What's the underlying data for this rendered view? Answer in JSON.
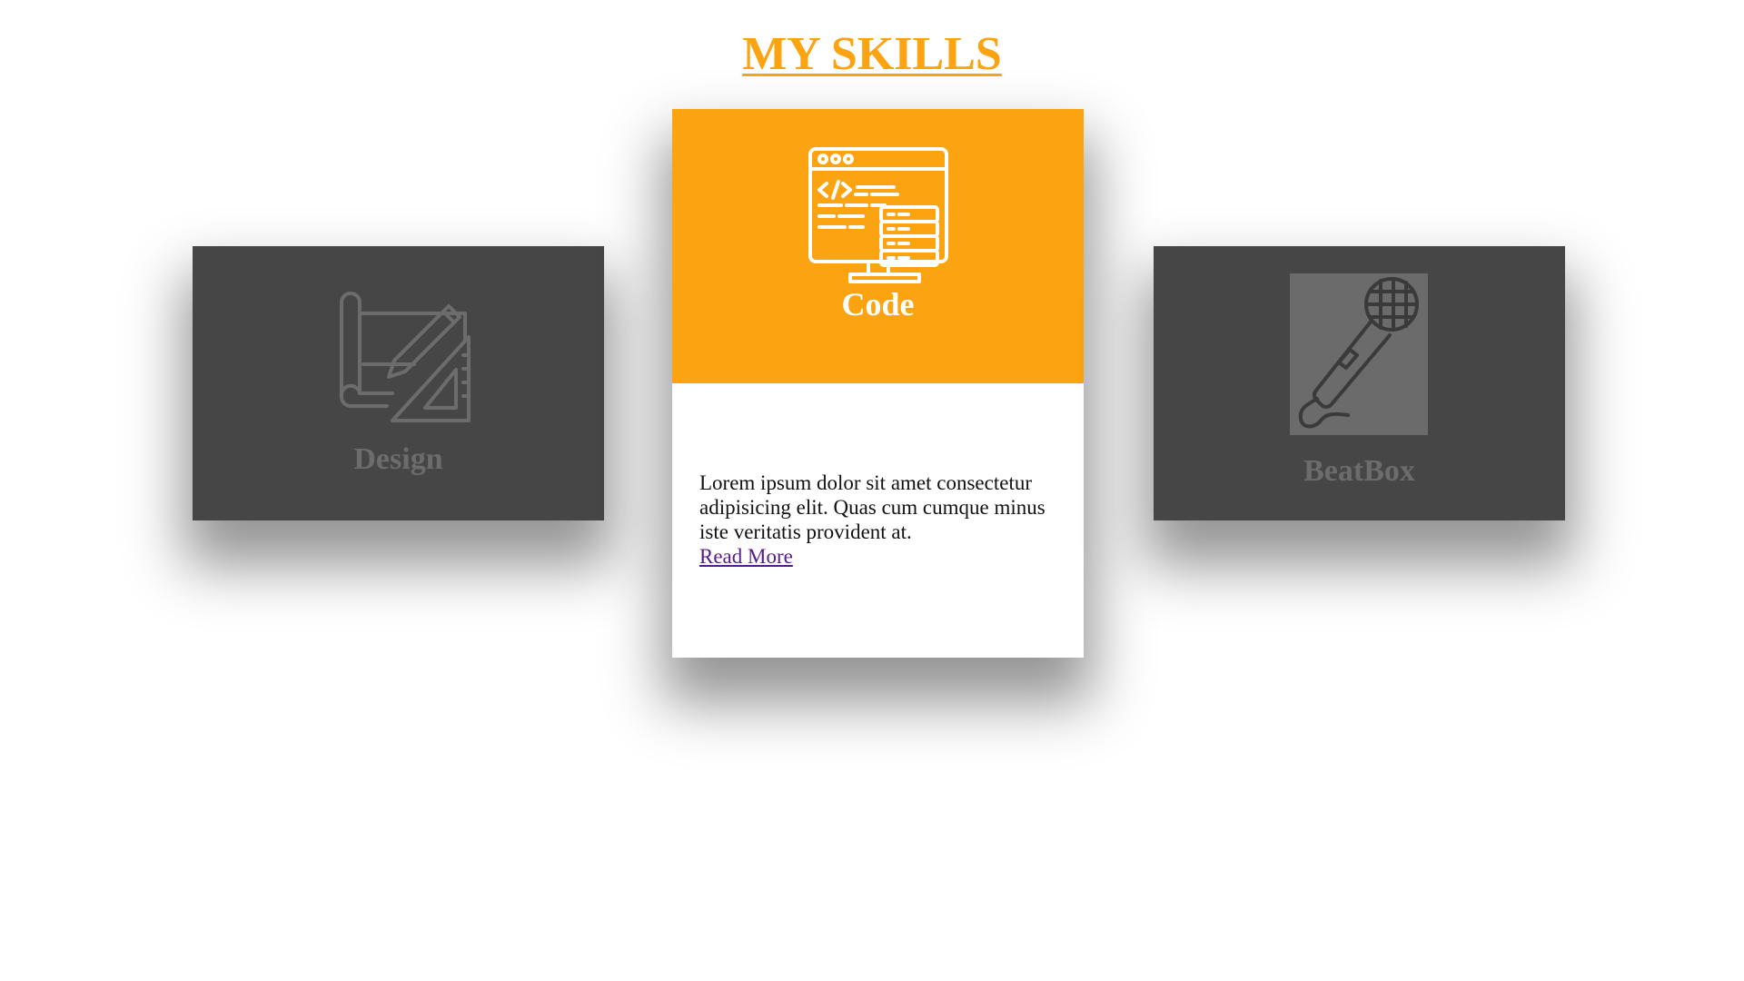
{
  "page": {
    "title": "MY SKILLS",
    "accent_color": "#fca311",
    "dark_card_color": "#464646"
  },
  "cards": [
    {
      "id": "design",
      "title": "Design",
      "icon": "design-drafting-icon",
      "active": false
    },
    {
      "id": "code",
      "title": "Code",
      "icon": "code-monitor-icon",
      "active": true,
      "description": "Lorem ipsum dolor sit amet consectetur adipisicing elit. Quas cum cumque minus iste veritatis provident at.",
      "link_label": "Read More"
    },
    {
      "id": "beatbox",
      "title": "BeatBox",
      "icon": "microphone-icon",
      "active": false
    }
  ]
}
